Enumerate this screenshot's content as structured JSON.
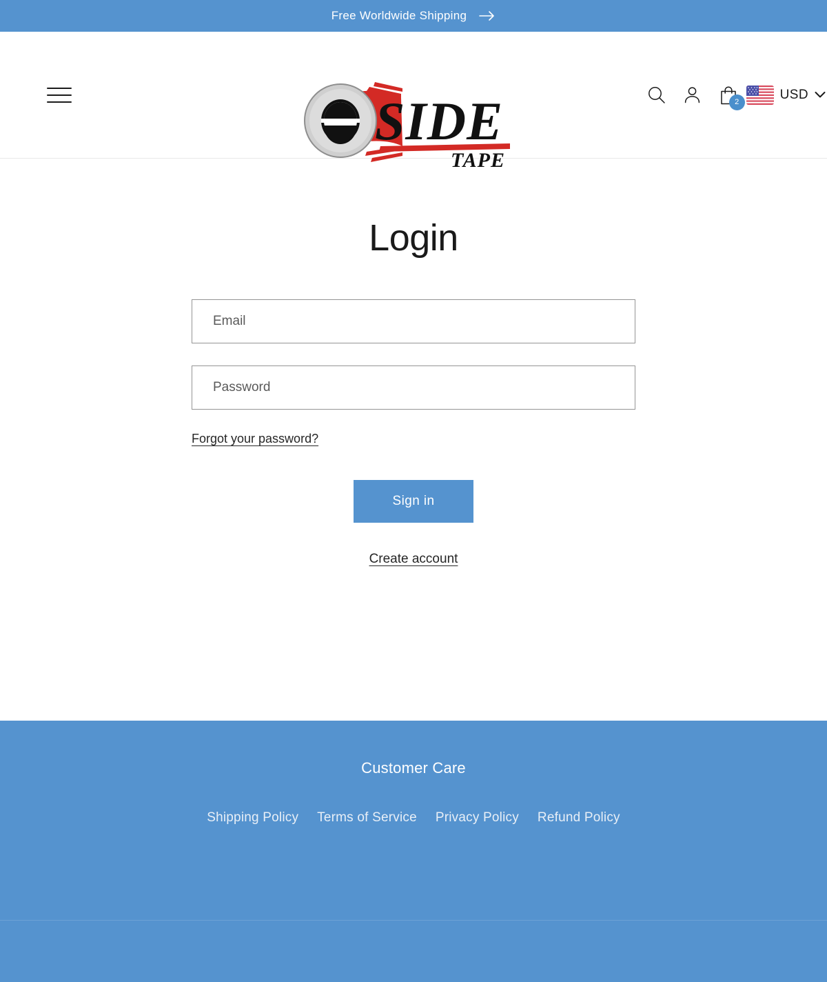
{
  "announcement": {
    "text": "Free Worldwide Shipping",
    "arrow_icon": "arrow-right-icon"
  },
  "header": {
    "menu_icon": "hamburger-menu-icon",
    "logo": {
      "brand": "SIDE",
      "sub": "TAPE",
      "icon": "tape-roll-icon"
    },
    "search_icon": "search-icon",
    "account_icon": "account-icon",
    "cart_icon": "shopping-bag-icon",
    "cart_count": "2",
    "flag_icon": "us-flag-icon",
    "currency": "USD",
    "currency_chevron": "chevron-down-icon"
  },
  "main": {
    "title": "Login",
    "email_placeholder": "Email",
    "password_placeholder": "Password",
    "email_value": "",
    "password_value": "",
    "forgot_password_label": "Forgot your password?",
    "sign_in_label": "Sign in",
    "create_account_label": "Create account"
  },
  "footer": {
    "title": "Customer Care",
    "links": [
      {
        "label": "Shipping Policy"
      },
      {
        "label": "Terms of Service"
      },
      {
        "label": "Privacy Policy"
      },
      {
        "label": "Refund Policy"
      }
    ]
  },
  "colors": {
    "accent_blue": "#5593CF",
    "badge_blue": "#4A8FCC",
    "logo_red": "#D32A25",
    "text_dark": "#1A1A1A"
  }
}
